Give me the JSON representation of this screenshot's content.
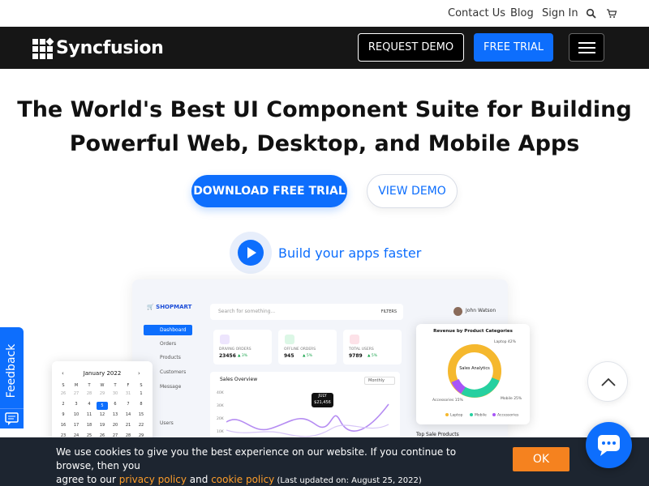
{
  "topbar": {
    "contact": "Contact Us",
    "blog": "Blog",
    "signin": "Sign In",
    "search_icon": "search-icon",
    "cart_icon": "cart-icon"
  },
  "nav": {
    "logo_text": "Syncfusion",
    "request_demo": "REQUEST DEMO",
    "free_trial": "FREE TRIAL",
    "menu_icon": "hamburger-icon"
  },
  "hero": {
    "title_line1": "The World's Best UI Component Suite for Building",
    "title_line2": "Powerful Web, Desktop, and Mobile Apps",
    "download_trial": "DOWNLOAD FREE TRIAL",
    "view_demo": "VIEW DEMO",
    "build_faster": "Build your apps faster"
  },
  "dashboard": {
    "brand": "SHOPMART",
    "nav_items": [
      "Dashboard",
      "Orders",
      "Products",
      "Customers",
      "Message",
      "Users"
    ],
    "search_placeholder": "Search for something...",
    "filters": "FILTERS",
    "user_name": "John Watson",
    "stats": [
      {
        "label": "DRIVING ORDERS",
        "value": "23456",
        "delta": "▲ 3%",
        "color": "#7c3aed"
      },
      {
        "label": "OFFLINE ORDERS",
        "value": "945",
        "delta": "▲ 5%",
        "color": "#16a34a"
      },
      {
        "label": "TOTAL USERS",
        "value": "9789",
        "delta": "▲ 5%",
        "color": "#e11d48"
      }
    ],
    "sales_title": "Sales Overview",
    "period": "Monthly",
    "y_ticks": [
      "40K",
      "30K",
      "20K",
      "10K"
    ],
    "tooltip_label": "JULY",
    "tooltip_value": "$21,456",
    "top_sale": "Top Sale Products"
  },
  "calendar": {
    "title": "January 2022",
    "prev": "‹",
    "next": "›",
    "weekdays": [
      "S",
      "M",
      "T",
      "W",
      "T",
      "F",
      "S"
    ],
    "days": [
      "26",
      "27",
      "28",
      "29",
      "30",
      "31",
      "1",
      "2",
      "3",
      "4",
      "5",
      "6",
      "7",
      "8",
      "9",
      "10",
      "11",
      "12",
      "13",
      "14",
      "15",
      "16",
      "17",
      "18",
      "19",
      "20",
      "21",
      "22",
      "23",
      "24",
      "25",
      "26",
      "27",
      "28",
      "29"
    ],
    "selected": "6"
  },
  "pie": {
    "title": "Revenue by Product Categories",
    "center": "Sales Analytics",
    "labels": [
      "Laptop 42%",
      "Accessories 15%",
      "Mobile 25%"
    ],
    "legend": [
      "Laptop",
      "Mobile",
      "Accessories"
    ],
    "colors": {
      "laptop": "#f5b82e",
      "mobile": "#26d0a0",
      "accessories": "#a855f7"
    }
  },
  "feedback": {
    "label": "Feedback",
    "icon": "feedback-chat-icon"
  },
  "cookie": {
    "line1": "We use cookies to give you the best experience on our website. If you continue to browse, then you",
    "line2_pre": "agree to our ",
    "privacy": "privacy policy",
    "and": " and ",
    "cookie_policy": "cookie policy",
    "updated": " (Last updated on: August 25, 2022)",
    "ok": "OK"
  },
  "colors": {
    "accent": "#0d6efd",
    "nav_bg": "#161616",
    "cookie_bg": "#1d2530",
    "ok": "#f5821f"
  }
}
